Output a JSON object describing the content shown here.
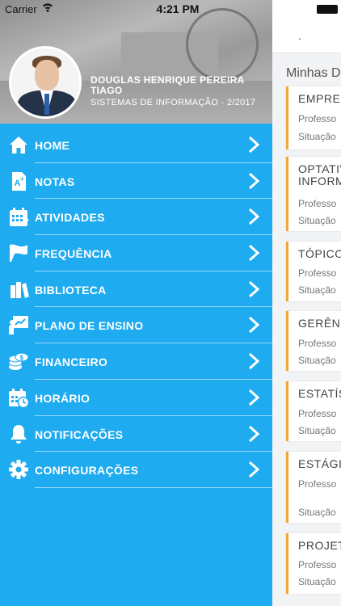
{
  "status_bar": {
    "carrier": "Carrier",
    "time": "4:21 PM"
  },
  "profile": {
    "name": "DOUGLAS HENRIQUE PEREIRA TIAGO",
    "course": "SISTEMAS DE INFORMAÇÃO - 2/2017"
  },
  "menu": {
    "items": [
      {
        "label": "HOME",
        "icon": "home-icon"
      },
      {
        "label": "NOTAS",
        "icon": "grades-icon"
      },
      {
        "label": "ATIVIDADES",
        "icon": "calendar-icon"
      },
      {
        "label": "FREQUÊNCIA",
        "icon": "flag-icon"
      },
      {
        "label": "BIBLIOTECA",
        "icon": "books-icon"
      },
      {
        "label": "PLANO DE ENSINO",
        "icon": "presentation-icon"
      },
      {
        "label": "FINANCEIRO",
        "icon": "coins-icon"
      },
      {
        "label": "HORÁRIO",
        "icon": "schedule-icon"
      },
      {
        "label": "NOTIFICAÇÕES",
        "icon": "bell-icon"
      },
      {
        "label": "CONFIGURAÇÕES",
        "icon": "gear-icon"
      }
    ]
  },
  "main": {
    "dot": ".",
    "section_title": "Minhas D",
    "cards": [
      {
        "title": "EMPREE",
        "line1": "Professo",
        "line2": "Situação"
      },
      {
        "title": "OPTATIV",
        "title2": "INFORM",
        "line1": "Professo",
        "line2": "Situação"
      },
      {
        "title": "TÓPICO",
        "line1": "Professo",
        "line2": "Situação"
      },
      {
        "title": "GERÊNC",
        "line1": "Professo",
        "line2": "Situação"
      },
      {
        "title": "ESTATÍS",
        "line1": "Professo",
        "line2": "Situação"
      },
      {
        "title": "ESTÁGIO",
        "line1": "Professo",
        "line2": "Situação"
      },
      {
        "title": "PROJET",
        "line1": "Professo",
        "line2": "Situação"
      }
    ]
  },
  "colors": {
    "drawer": "#1eabf0",
    "card_accent": "#f0a63a"
  }
}
